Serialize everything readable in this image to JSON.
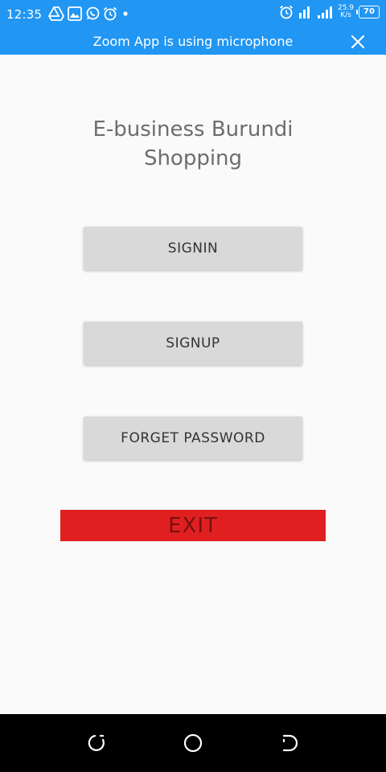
{
  "status_bar": {
    "time": "12:35",
    "net_speed_value": "25.9",
    "net_speed_unit": "K/s",
    "battery_level": "70",
    "left_icons": [
      "drive-icon",
      "image-icon",
      "whatsapp-icon",
      "alarm-icon",
      "dot-icon"
    ],
    "right_icons": [
      "alarm-icon",
      "signal-icon"
    ]
  },
  "notification": {
    "text": "Zoom App is using microphone",
    "close_icon": "close-icon"
  },
  "app": {
    "title_line1": "E-business Burundi",
    "title_line2": "Shopping"
  },
  "buttons": {
    "signin": "SIGNIN",
    "signup": "SIGNUP",
    "forget_password": "FORGET PASSWORD",
    "exit": "EXIT"
  },
  "nav_bar": {
    "icons": [
      "back-icon",
      "home-icon",
      "recents-icon"
    ]
  },
  "colors": {
    "accent": "#2196f3",
    "background": "#fafafa",
    "button_bg": "#d9d9d9",
    "exit_bg": "#e02020",
    "exit_text": "#7a1010",
    "title_text": "#6d6d6d"
  }
}
